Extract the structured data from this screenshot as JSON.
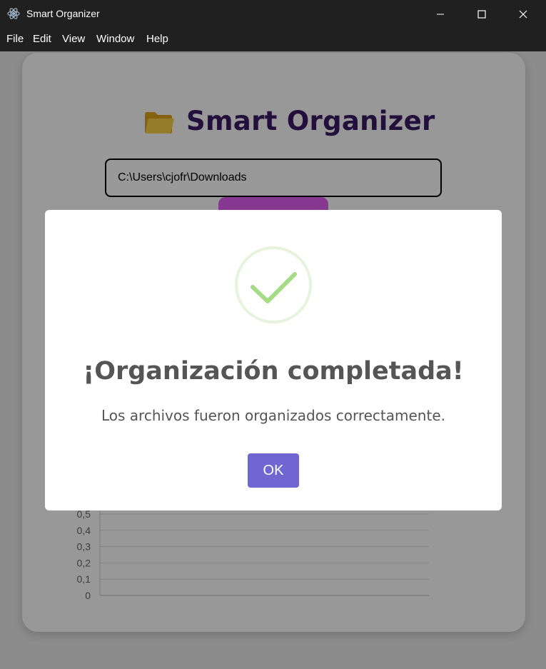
{
  "window": {
    "title": "Smart Organizer"
  },
  "menu": {
    "items": [
      {
        "label": "File"
      },
      {
        "label": "Edit"
      },
      {
        "label": "View"
      },
      {
        "label": "Window"
      },
      {
        "label": "Help"
      }
    ]
  },
  "app": {
    "title": "Smart Organizer",
    "path_value": "C:\\Users\\cjofr\\Downloads",
    "accent_color": "#3b1a63",
    "button_color": "#e05ef0"
  },
  "chart_data": {
    "type": "bar",
    "categories": [],
    "values": [],
    "y_ticks": [
      "0,5",
      "0,4",
      "0,3",
      "0,2",
      "0,1",
      "0"
    ],
    "ylim": [
      0,
      0.5
    ],
    "grid": true
  },
  "dialog": {
    "icon": "success-check-icon",
    "title": "¡Organización completada!",
    "message": "Los archivos fueron organizados correctamente.",
    "ok_label": "OK",
    "ok_color": "#7066d2",
    "success_color": "#a5dc86"
  }
}
